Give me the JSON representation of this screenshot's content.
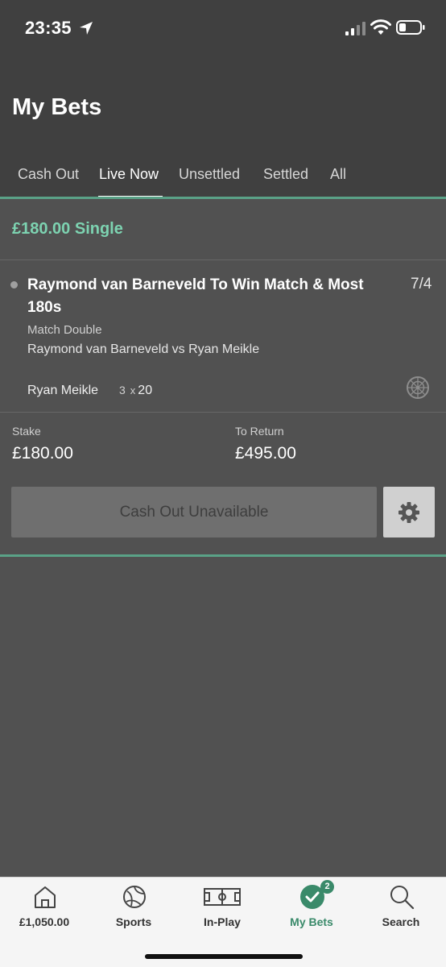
{
  "status_bar": {
    "time": "23:35"
  },
  "header": {
    "title": "My Bets"
  },
  "tabs": [
    {
      "label": "Cash Out"
    },
    {
      "label": "Live Now"
    },
    {
      "label": "Unsettled"
    },
    {
      "label": "Settled"
    },
    {
      "label": "All"
    }
  ],
  "active_tab": "Live Now",
  "bet": {
    "type_label": "£180.00 Single",
    "selection": "Raymond van Barneveld To Win Match & Most 180s",
    "odds": "7/4",
    "market": "Match Double",
    "event": "Raymond van Barneveld vs Ryan Meikle",
    "live_player": "Ryan Meikle",
    "live_score": {
      "multiplier": "3",
      "x": "x",
      "value": "20"
    },
    "stake_label": "Stake",
    "stake_value": "£180.00",
    "return_label": "To Return",
    "return_value": "£495.00",
    "cashout_label": "Cash Out Unavailable"
  },
  "bottom_nav": {
    "items": [
      {
        "label": "£1,050.00",
        "icon": "home-icon"
      },
      {
        "label": "Sports",
        "icon": "football-icon"
      },
      {
        "label": "In-Play",
        "icon": "pitch-icon"
      },
      {
        "label": "My Bets",
        "icon": "checkmark-icon",
        "badge": "2"
      },
      {
        "label": "Search",
        "icon": "search-icon"
      }
    ]
  },
  "colors": {
    "accent": "#7dd3b1",
    "nav_active": "#3a8a6a",
    "divider_green": "#5aa287",
    "background": "#515151",
    "header_bg": "#404040"
  }
}
